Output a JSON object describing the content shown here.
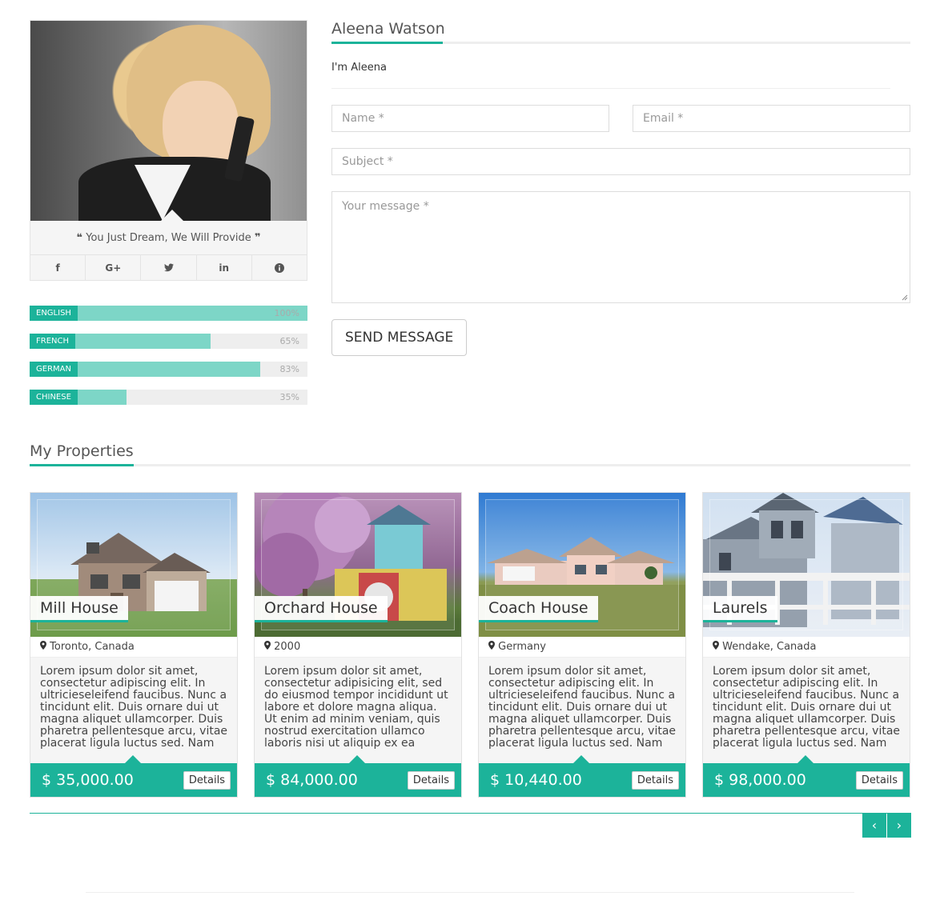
{
  "agent": {
    "quote": "You Just Dream, We Will Provide",
    "quote_open": "❝",
    "quote_close": "❞",
    "social": [
      {
        "name": "facebook-icon",
        "glyph": "f"
      },
      {
        "name": "google-plus-icon",
        "glyph": "G+"
      },
      {
        "name": "twitter-icon",
        "glyph": "🐦"
      },
      {
        "name": "linkedin-icon",
        "glyph": "in"
      },
      {
        "name": "info-icon",
        "glyph": "ℹ"
      }
    ]
  },
  "skills": [
    {
      "label": "ENGLISH",
      "percent_text": "100%",
      "value": 100
    },
    {
      "label": "FRENCH",
      "percent_text": "65%",
      "value": 65
    },
    {
      "label": "GERMAN",
      "percent_text": "83%",
      "value": 83
    },
    {
      "label": "CHINESE",
      "percent_text": "35%",
      "value": 35
    }
  ],
  "contact": {
    "title": "Aleena Watson",
    "intro": "I'm Aleena",
    "name_placeholder": "Name *",
    "email_placeholder": "Email *",
    "subject_placeholder": "Subject *",
    "message_placeholder": "Your message *",
    "send_label": "SEND MESSAGE"
  },
  "properties": {
    "title": "My Properties",
    "items": [
      {
        "name": "Mill House",
        "location": "Toronto, Canada",
        "description": "Lorem ipsum dolor sit amet, consectetur adipiscing elit. In ultricieseleifend faucibus. Nunc a tincidunt elit. Duis ornare dui ut magna aliquet ullamcorper. Duis pharetra pellentesque arcu, vitae placerat ligula luctus sed. Nam",
        "price": "$ 35,000.00",
        "details_label": "Details"
      },
      {
        "name": "Orchard House",
        "location": "2000",
        "description": "Lorem ipsum dolor sit amet, consectetur adipisicing elit, sed do eiusmod tempor incididunt ut labore et dolore magna aliqua. Ut enim ad minim veniam, quis nostrud exercitation ullamco laboris nisi ut aliquip ex ea",
        "price": "$ 84,000.00",
        "details_label": "Details"
      },
      {
        "name": "Coach House",
        "location": "Germany",
        "description": "Lorem ipsum dolor sit amet, consectetur adipiscing elit. In ultricieseleifend faucibus. Nunc a tincidunt elit. Duis ornare dui ut magna aliquet ullamcorper. Duis pharetra pellentesque arcu, vitae placerat ligula luctus sed. Nam",
        "price": "$ 10,440.00",
        "details_label": "Details"
      },
      {
        "name": "Laurels",
        "location": "Wendake, Canada",
        "description": "Lorem ipsum dolor sit amet, consectetur adipiscing elit. In ultricieseleifend faucibus. Nunc a tincidunt elit. Duis ornare dui ut magna aliquet ullamcorper. Duis pharetra pellentesque arcu, vitae placerat ligula luctus sed. Nam",
        "price": "$ 98,000.00",
        "details_label": "Details"
      }
    ]
  },
  "pager": {
    "prev": "‹",
    "next": "›"
  },
  "colors": {
    "accent": "#1cb39a",
    "bar_fill": "#7dd6c7",
    "bar_track": "#eeeeee"
  }
}
